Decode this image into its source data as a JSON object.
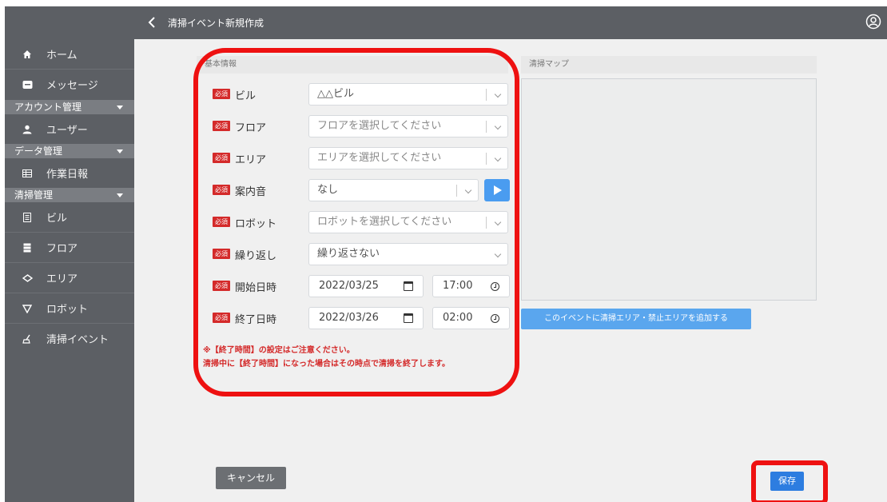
{
  "header": {
    "title": "清掃イベント新規作成"
  },
  "sidebar": {
    "home": "ホーム",
    "messages": "メッセージ",
    "account_section": "アカウント管理",
    "users": "ユーザー",
    "data_section": "データ管理",
    "work_log": "作業日報",
    "cleaning_section": "清掃管理",
    "building": "ビル",
    "floor": "フロア",
    "area": "エリア",
    "robot": "ロボット",
    "cleaning_event": "清掃イベント"
  },
  "basic_info": {
    "header": "基本情報",
    "required_badge": "必須",
    "building": {
      "label": "ビル",
      "value": "△△ビル"
    },
    "floor": {
      "label": "フロア",
      "placeholder": "フロアを選択してください"
    },
    "area": {
      "label": "エリア",
      "placeholder": "エリアを選択してください"
    },
    "announcement": {
      "label": "案内音",
      "value": "なし"
    },
    "robot": {
      "label": "ロボット",
      "placeholder": "ロボットを選択してください"
    },
    "repeat": {
      "label": "繰り返し",
      "value": "繰り返さない"
    },
    "start": {
      "label": "開始日時",
      "date": "2022/03/25",
      "time": "17:00"
    },
    "end": {
      "label": "終了日時",
      "date": "2022/03/26",
      "time": "02:00"
    },
    "note_line1": "※【終了時間】の設定はご注意ください。",
    "note_line2": "清掃中に【終了時間】になった場合はその時点で清掃を終了します。"
  },
  "map": {
    "header": "清掃マップ",
    "add_area_button": "このイベントに清掃エリア・禁止エリアを追加する"
  },
  "footer": {
    "cancel": "キャンセル",
    "save": "保存"
  },
  "colors": {
    "sidebar": "#5c5f64",
    "required": "#d42a2a",
    "primary": "#2d7de0",
    "highlight": "#ee1111"
  }
}
